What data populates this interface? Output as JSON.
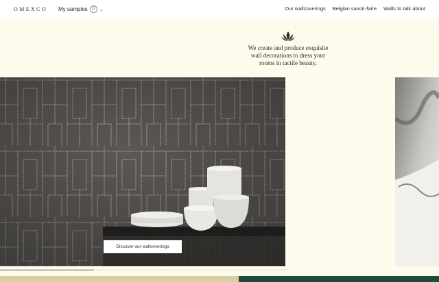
{
  "header": {
    "logo": "OMEXCO",
    "samples_label": "My samples",
    "samples_count": "0",
    "nav": [
      "Our wallcoverings",
      "Belgian savoir-faire",
      "Walls to talk about"
    ]
  },
  "intro": {
    "line1": "We create and produce exquisite",
    "line2": "wall decorations to dress your",
    "line3": "rooms in tactile beauty."
  },
  "hero": {
    "button_label": "Discover our wallcoverings"
  },
  "carousel": {
    "progress": 0.33
  },
  "colors": {
    "background": "#fdfbec",
    "header": "#ffffff",
    "green_band": "#1f4a3c"
  }
}
